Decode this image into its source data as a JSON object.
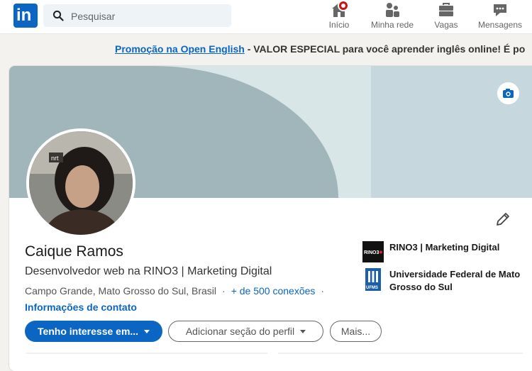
{
  "nav": {
    "logo_text": "in",
    "search_placeholder": "Pesquisar",
    "items": [
      {
        "label": "Início",
        "icon": "home-icon",
        "has_badge": true
      },
      {
        "label": "Minha rede",
        "icon": "network-icon"
      },
      {
        "label": "Vagas",
        "icon": "briefcase-icon"
      },
      {
        "label": "Mensagens",
        "icon": "messaging-icon"
      }
    ]
  },
  "promo": {
    "link_text": "Promoção na Open English",
    "rest_text": "- VALOR ESPECIAL para você aprender inglês online! É po"
  },
  "profile": {
    "name": "Caique Ramos",
    "headline": "Desenvolvedor web na RINO3 | Marketing Digital",
    "location": "Campo Grande, Mato Grosso do Sul, Brasil",
    "connections": "+ de 500 conexões",
    "contact_info": "Informações de contato",
    "avatar_shirt_text": "nrt",
    "organizations": [
      {
        "name": "RINO3 | Marketing Digital",
        "logo_text": "RINO3"
      },
      {
        "name": "Universidade Federal de Mato Grosso do Sul",
        "logo_text": "UFMS"
      }
    ]
  },
  "actions": {
    "primary": "Tenho interesse em...",
    "add_section": "Adicionar seção do perfil",
    "more": "Mais..."
  },
  "colors": {
    "brand": "#0a66c2",
    "badge": "#cc1016",
    "banner_dark": "#a1b6bb",
    "banner_light": "#c6d8dd"
  }
}
